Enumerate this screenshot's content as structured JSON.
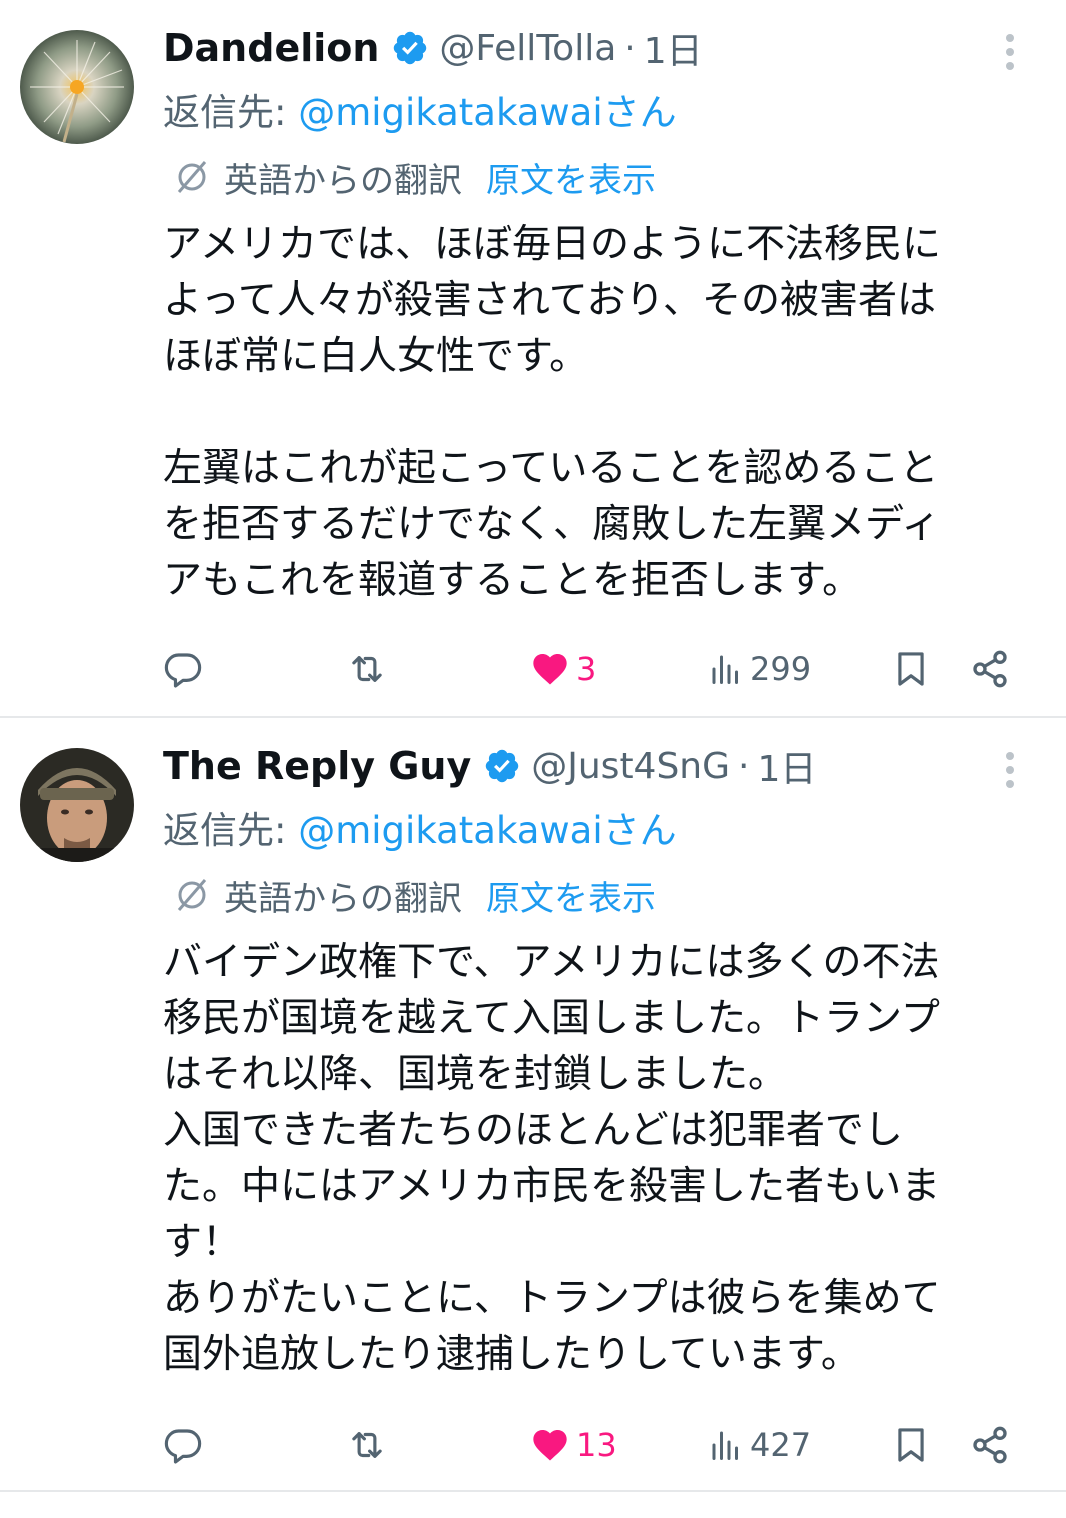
{
  "tweets": [
    {
      "author_name": "Dandelion",
      "handle": "@FellTolla",
      "separator": "·",
      "time": "1日",
      "reply_prefix": "返信先: ",
      "reply_mention": "@migikatakawaiさん",
      "translation_label": "英語からの翻訳",
      "show_original_label": "原文を表示",
      "body": "アメリカでは、ほぼ毎日のように不法移民に\nよって人々が殺害されており、その被害者は\nほぼ常に白人女性です。\n\n左翼はこれが起こっていることを認めること\nを拒否するだけでなく、腐敗した左翼メディ\nアもこれを報道することを拒否します。",
      "likes": "3",
      "views": "299",
      "avatar_icon": "dandelion-avatar",
      "liked": true
    },
    {
      "author_name": "The Reply Guy",
      "handle": "@Just4SnG",
      "separator": "·",
      "time": "1日",
      "reply_prefix": "返信先: ",
      "reply_mention": "@migikatakawaiさん",
      "translation_label": "英語からの翻訳",
      "show_original_label": "原文を表示",
      "body": "バイデン政権下で、アメリカには多くの不法\n移民が国境を越えて入国しました。トランプ\nはそれ以降、国境を封鎖しました。\n入国できた者たちのほとんどは犯罪者でし\nた。中にはアメリカ市民を殺害した者もいま\nす！\nありがたいことに、トランプは彼らを集めて\n国外追放したり逮捕したりしています。",
      "likes": "13",
      "views": "427",
      "avatar_icon": "man-with-cap-avatar",
      "liked": true
    }
  ],
  "colors": {
    "link": "#1d9bf0",
    "secondary_text": "#536471",
    "like": "#f91880",
    "primary_text": "#0f1419",
    "divider": "#e6e8ea"
  }
}
